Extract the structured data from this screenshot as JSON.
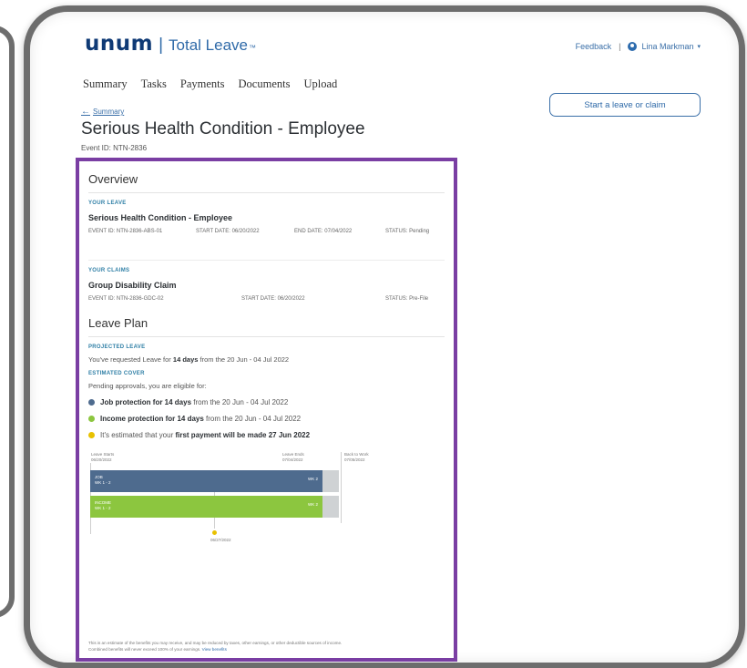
{
  "header": {
    "logo_word": "unum",
    "logo_sep": "|",
    "product_name": "Total Leave",
    "trademark": "™",
    "feedback": "Feedback",
    "divider": "|",
    "user_name": "Lina Markman",
    "caret": "▾"
  },
  "nav": [
    "Summary",
    "Tasks",
    "Payments",
    "Documents",
    "Upload"
  ],
  "cta_label": "Start a leave or claim",
  "back_arrow": "←",
  "back_link": "Summary",
  "page_title": "Serious Health Condition - Employee",
  "event_id": "Event ID: NTN-2836",
  "overview": {
    "heading": "Overview",
    "leave": {
      "label": "YOUR LEAVE",
      "title": "Serious Health Condition - Employee",
      "event_id": "EVENT ID: NTN-2836-ABS-01",
      "start_date": "START DATE: 06/20/2022",
      "end_date": "END DATE: 07/04/2022",
      "status": "STATUS: Pending"
    },
    "claims": {
      "label": "YOUR CLAIMS",
      "title": "Group Disability Claim",
      "event_id": "EVENT ID: NTN-2836-GDC-02",
      "start_date": "START DATE: 06/20/2022",
      "status": "STATUS: Pre-File"
    }
  },
  "leave_plan": {
    "heading": "Leave Plan",
    "projected_label": "PROJECTED LEAVE",
    "projected_pre": "You've requested Leave for",
    "projected_bold": "14 days",
    "projected_post": "from the 20 Jun - 04 Jul 2022",
    "estimated_label": "ESTIMATED COVER",
    "estimated_text": "Pending approvals, you are eligible for:",
    "bullets": [
      {
        "color": "#4e6b8e",
        "bold": "Job protection for 14 days",
        "rest": "from the 20 Jun - 04 Jul 2022"
      },
      {
        "color": "#8cc63f",
        "bold": "Income protection for 14 days",
        "rest": "from the 20 Jun - 04 Jul 2022"
      },
      {
        "color": "#e8c100",
        "pre": "It's estimated that your",
        "bold": "first payment will be made 27 Jun 2022"
      }
    ]
  },
  "timeline": {
    "leave_starts": "Leave Starts",
    "leave_starts_date": "06/20/2022",
    "leave_ends": "Leave Ends",
    "leave_ends_date": "07/04/2022",
    "back_to_work": "Back to Work",
    "back_to_work_date": "07/05/2022",
    "job_bar_label": "JOB",
    "job_bar_sub": "WK 1 - 2",
    "job_bar_right": "WK 2",
    "income_bar_label": "INCOME",
    "income_bar_sub": "WK 1 - 2",
    "income_bar_right": "WK 2",
    "payment_date": "06/27/2022"
  },
  "disclaimer_text": "This is an estimate of the benefits you may receive, and may be reduced by taxes, other earnings, or other deductible sources of income. Combined benefits will never exceed 100% of your earnings.",
  "disclaimer_link": "View benefits",
  "colors": {
    "brand_navy": "#0f3a75",
    "link_blue": "#2f6aa8",
    "highlight_purple": "#7a3ea3",
    "job_bar": "#4e6b8e",
    "income_bar": "#8cc63f",
    "payment_yellow": "#e8c100"
  }
}
